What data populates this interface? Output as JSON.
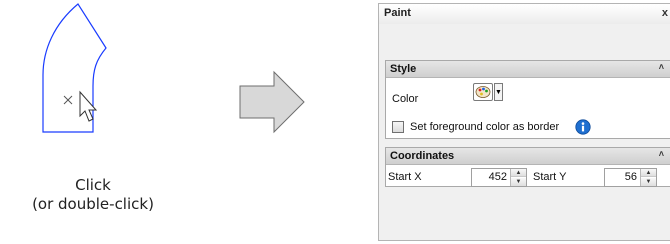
{
  "illustration": {
    "caption_line1": "Click",
    "caption_line2": "(or double-click)"
  },
  "panel": {
    "title": "Paint",
    "close_glyph": "x",
    "style_group": {
      "header": "Style",
      "color_label": "Color",
      "border_checkbox_label": "Set foreground color as border",
      "border_checkbox_checked": false
    },
    "coordinates_group": {
      "header": "Coordinates",
      "start_x_label": "Start X",
      "start_x_value": "452",
      "start_y_label": "Start Y",
      "start_y_value": "56"
    }
  },
  "colors": {
    "shape_outline": "#1a3cff",
    "arrow_fill": "#d8d8d8",
    "info_icon": "#1f6fd0"
  },
  "icons": [
    "cursor-icon",
    "crosshair-icon",
    "right-arrow-icon",
    "palette-icon",
    "info-icon",
    "collapse-caret-icon"
  ]
}
